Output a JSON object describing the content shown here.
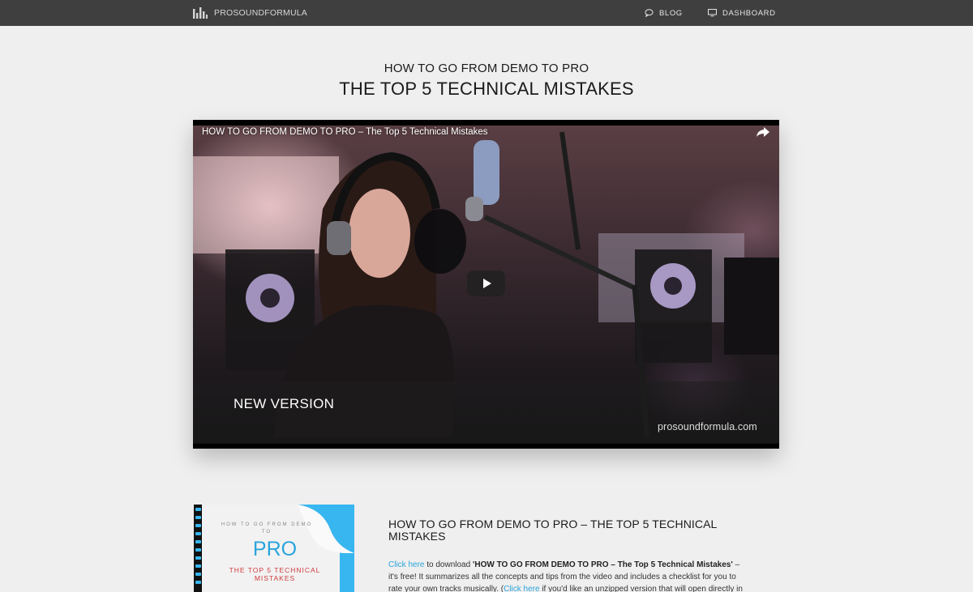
{
  "nav": {
    "logo_text": "PROSOUNDFORMULA",
    "blog_label": "BLOG",
    "dashboard_label": "DASHBOARD"
  },
  "hero": {
    "pre_title": "HOW TO GO FROM DEMO TO PRO",
    "title": "THE TOP 5 TECHNICAL MISTAKES"
  },
  "video": {
    "title": "HOW TO GO FROM DEMO TO PRO – The Top 5 Technical Mistakes",
    "overlay_text": "NEW VERSION",
    "watermark": "prosoundformula.com"
  },
  "ebook": {
    "small_text": "HOW TO GO FROM DEMO TO",
    "big_text": "PRO",
    "subtitle": "THE TOP 5 TECHNICAL MISTAKES"
  },
  "section": {
    "title": "HOW TO GO FROM DEMO TO PRO – THE TOP 5 TECHNICAL MISTAKES",
    "link1": "Click here",
    "text1": " to download ",
    "bold": "'HOW TO GO FROM DEMO TO PRO – The Top 5 Technical Mistakes'",
    "text2": " – it's free! It summarizes all the concepts and tips from the video and includes a checklist for you to rate your own tracks musically. (",
    "link2": "Click here",
    "text3": " if you'd like an unzipped version that will open directly in your"
  },
  "colors": {
    "nav_bg": "#3f3f3f",
    "page_bg": "#efefef",
    "link": "#2aa4dc",
    "ebook_accent": "#38b6f0",
    "ebook_red": "#cf3b3b"
  }
}
